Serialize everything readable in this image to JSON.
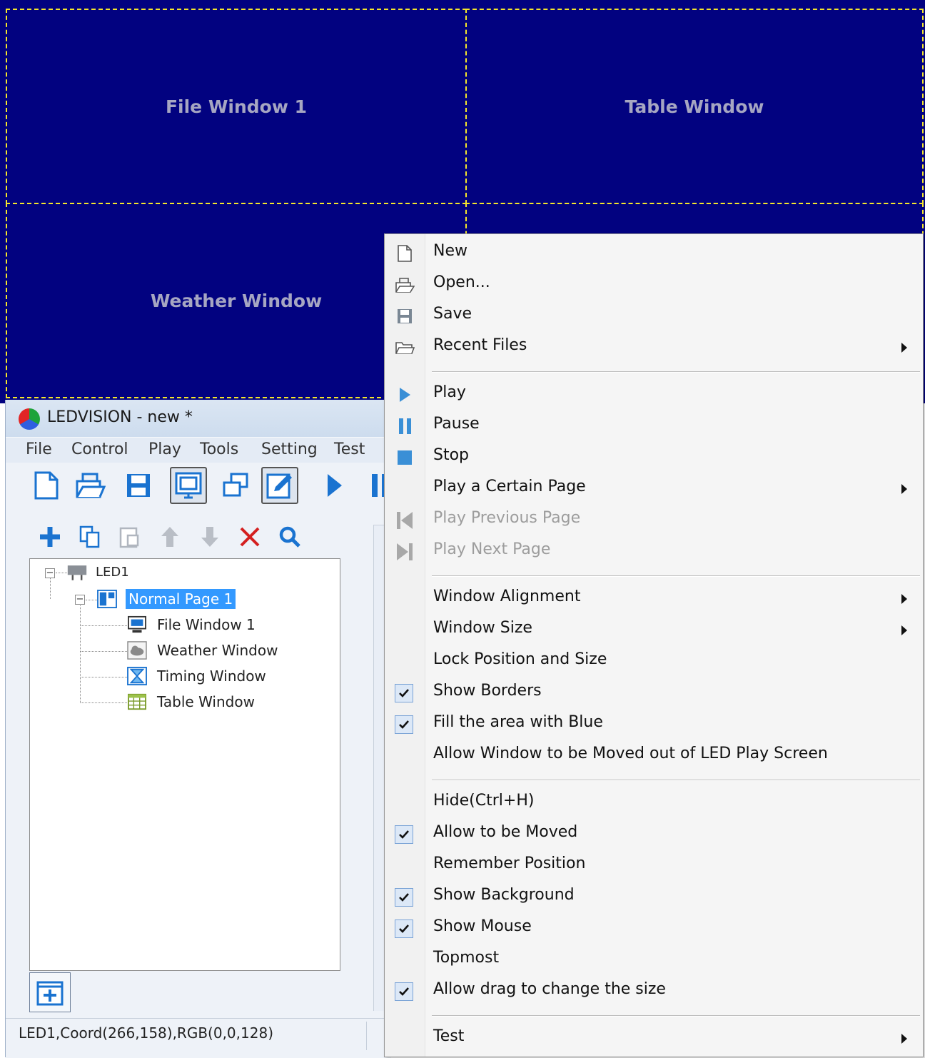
{
  "led_screen": {
    "windows": {
      "file": "File Window 1",
      "table": "Table Window",
      "weather": "Weather Window"
    }
  },
  "app": {
    "title": "LEDVISION - new *",
    "menu": [
      "File",
      "Control",
      "Play",
      "Tools",
      "Setting",
      "Test"
    ],
    "toolbar_icons": [
      "new-file-icon",
      "open-icon",
      "save-icon",
      "screen-icon",
      "windows-icon",
      "edit-icon",
      "play-icon",
      "pause-icon"
    ]
  },
  "tree_toolbar_icons": [
    "add-icon",
    "copy-icon",
    "paste-icon",
    "move-up-icon",
    "move-down-icon",
    "delete-icon",
    "search-icon"
  ],
  "tree": {
    "root": "LED1",
    "page": "Normal Page 1",
    "children": [
      "File Window 1",
      "Weather Window",
      "Timing Window",
      "Table Window"
    ]
  },
  "status": {
    "text": "LED1,Coord(266,158),RGB(0,0,128)"
  },
  "context_menu": {
    "items": {
      "new": "New",
      "open": "Open...",
      "save": "Save",
      "recent": "Recent Files",
      "play": "Play",
      "pause": "Pause",
      "stop": "Stop",
      "play_certain": "Play a Certain Page",
      "play_prev": "Play Previous Page",
      "play_next": "Play Next Page",
      "align": "Window Alignment",
      "size": "Window Size",
      "lock": "Lock Position and Size",
      "borders": "Show Borders",
      "fill_blue": "Fill the area with Blue",
      "allow_out": "Allow Window to be Moved out of LED Play Screen",
      "hide": "Hide(Ctrl+H)",
      "allow_moved": "Allow to be Moved",
      "remember": "Remember Position",
      "show_bg": "Show Background",
      "show_mouse": "Show Mouse",
      "topmost": "Topmost",
      "allow_drag": "Allow drag to change the size",
      "test": "Test"
    },
    "checked": {
      "borders": true,
      "fill_blue": true,
      "allow_moved": true,
      "show_bg": true,
      "show_mouse": true,
      "allow_drag": true
    },
    "disabled": [
      "play_prev",
      "play_next"
    ]
  },
  "colors": {
    "led_background": "#020280",
    "window_border": "#f5e72a",
    "selection": "#3399ff",
    "accent_blue": "#1a73d0",
    "delete_red": "#d42020"
  }
}
